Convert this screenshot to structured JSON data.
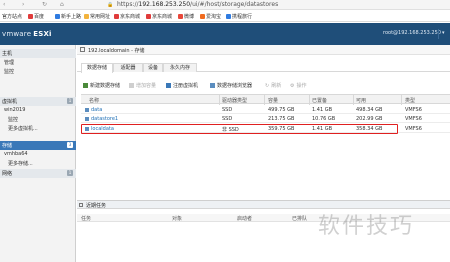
{
  "browser": {
    "url_scheme": "https://",
    "url_host": "192.168.253.250",
    "url_path": "/ui/#/host/storage/datastores",
    "bookmarks": [
      "官方站点",
      "百度",
      "新手上路",
      "常用网址",
      "京东商城",
      "京东商城",
      "微博",
      "爱淘宝",
      "携程旅行"
    ]
  },
  "header": {
    "brand_prefix": "vmware",
    "brand_suffix": "ESXi",
    "user": "root@192.168.253.250",
    "accent_color": "#1f4e79"
  },
  "navigator": {
    "rows": [
      {
        "label": "主机",
        "type": "header",
        "badge": ""
      },
      {
        "label": "管理",
        "type": "item",
        "badge": ""
      },
      {
        "label": "监控",
        "type": "item",
        "badge": ""
      },
      {
        "label": "虚拟机",
        "type": "header",
        "badge": "1"
      },
      {
        "label": "win2019",
        "type": "item",
        "badge": ""
      },
      {
        "label": "监控",
        "type": "sub",
        "badge": ""
      },
      {
        "label": "更多虚拟机...",
        "type": "sub",
        "badge": ""
      },
      {
        "label": "存储",
        "type": "active",
        "badge": "3"
      },
      {
        "label": "vmhba64",
        "type": "item",
        "badge": ""
      },
      {
        "label": "更多存储...",
        "type": "sub",
        "badge": ""
      },
      {
        "label": "网络",
        "type": "header",
        "badge": "1"
      }
    ]
  },
  "main": {
    "title": "192.localdomain - 存储",
    "tabs": [
      "数据存储",
      "适配器",
      "设备",
      "永久内存"
    ],
    "toolbar": [
      {
        "label": "新建数据存储",
        "disabled": false
      },
      {
        "label": "增加容量",
        "disabled": true
      },
      {
        "label": "注册虚拟机",
        "disabled": false
      },
      {
        "label": "数据存储浏览器",
        "disabled": false
      },
      {
        "label": "刷新",
        "disabled": true
      },
      {
        "label": "操作",
        "disabled": true
      }
    ],
    "columns": [
      "名称",
      "驱动器类型",
      "容量",
      "已置备",
      "可用",
      "类型"
    ],
    "rows": [
      {
        "name": "data",
        "drive": "SSD",
        "capacity": "499.75 GB",
        "provisioned": "1.41 GB",
        "free": "498.34 GB",
        "type": "VMFS6"
      },
      {
        "name": "datastore1",
        "drive": "SSD",
        "capacity": "213.75 GB",
        "provisioned": "10.76 GB",
        "free": "202.99 GB",
        "type": "VMFS6"
      },
      {
        "name": "localdata",
        "drive": "非 SSD",
        "capacity": "359.75 GB",
        "provisioned": "1.41 GB",
        "free": "358.34 GB",
        "type": "VMFS6"
      }
    ],
    "highlight_color": "#e02020"
  },
  "tasks": {
    "title": "近期任务",
    "columns": [
      "任务",
      "对象",
      "启动者",
      "已排队"
    ]
  },
  "watermark": "软件技巧"
}
